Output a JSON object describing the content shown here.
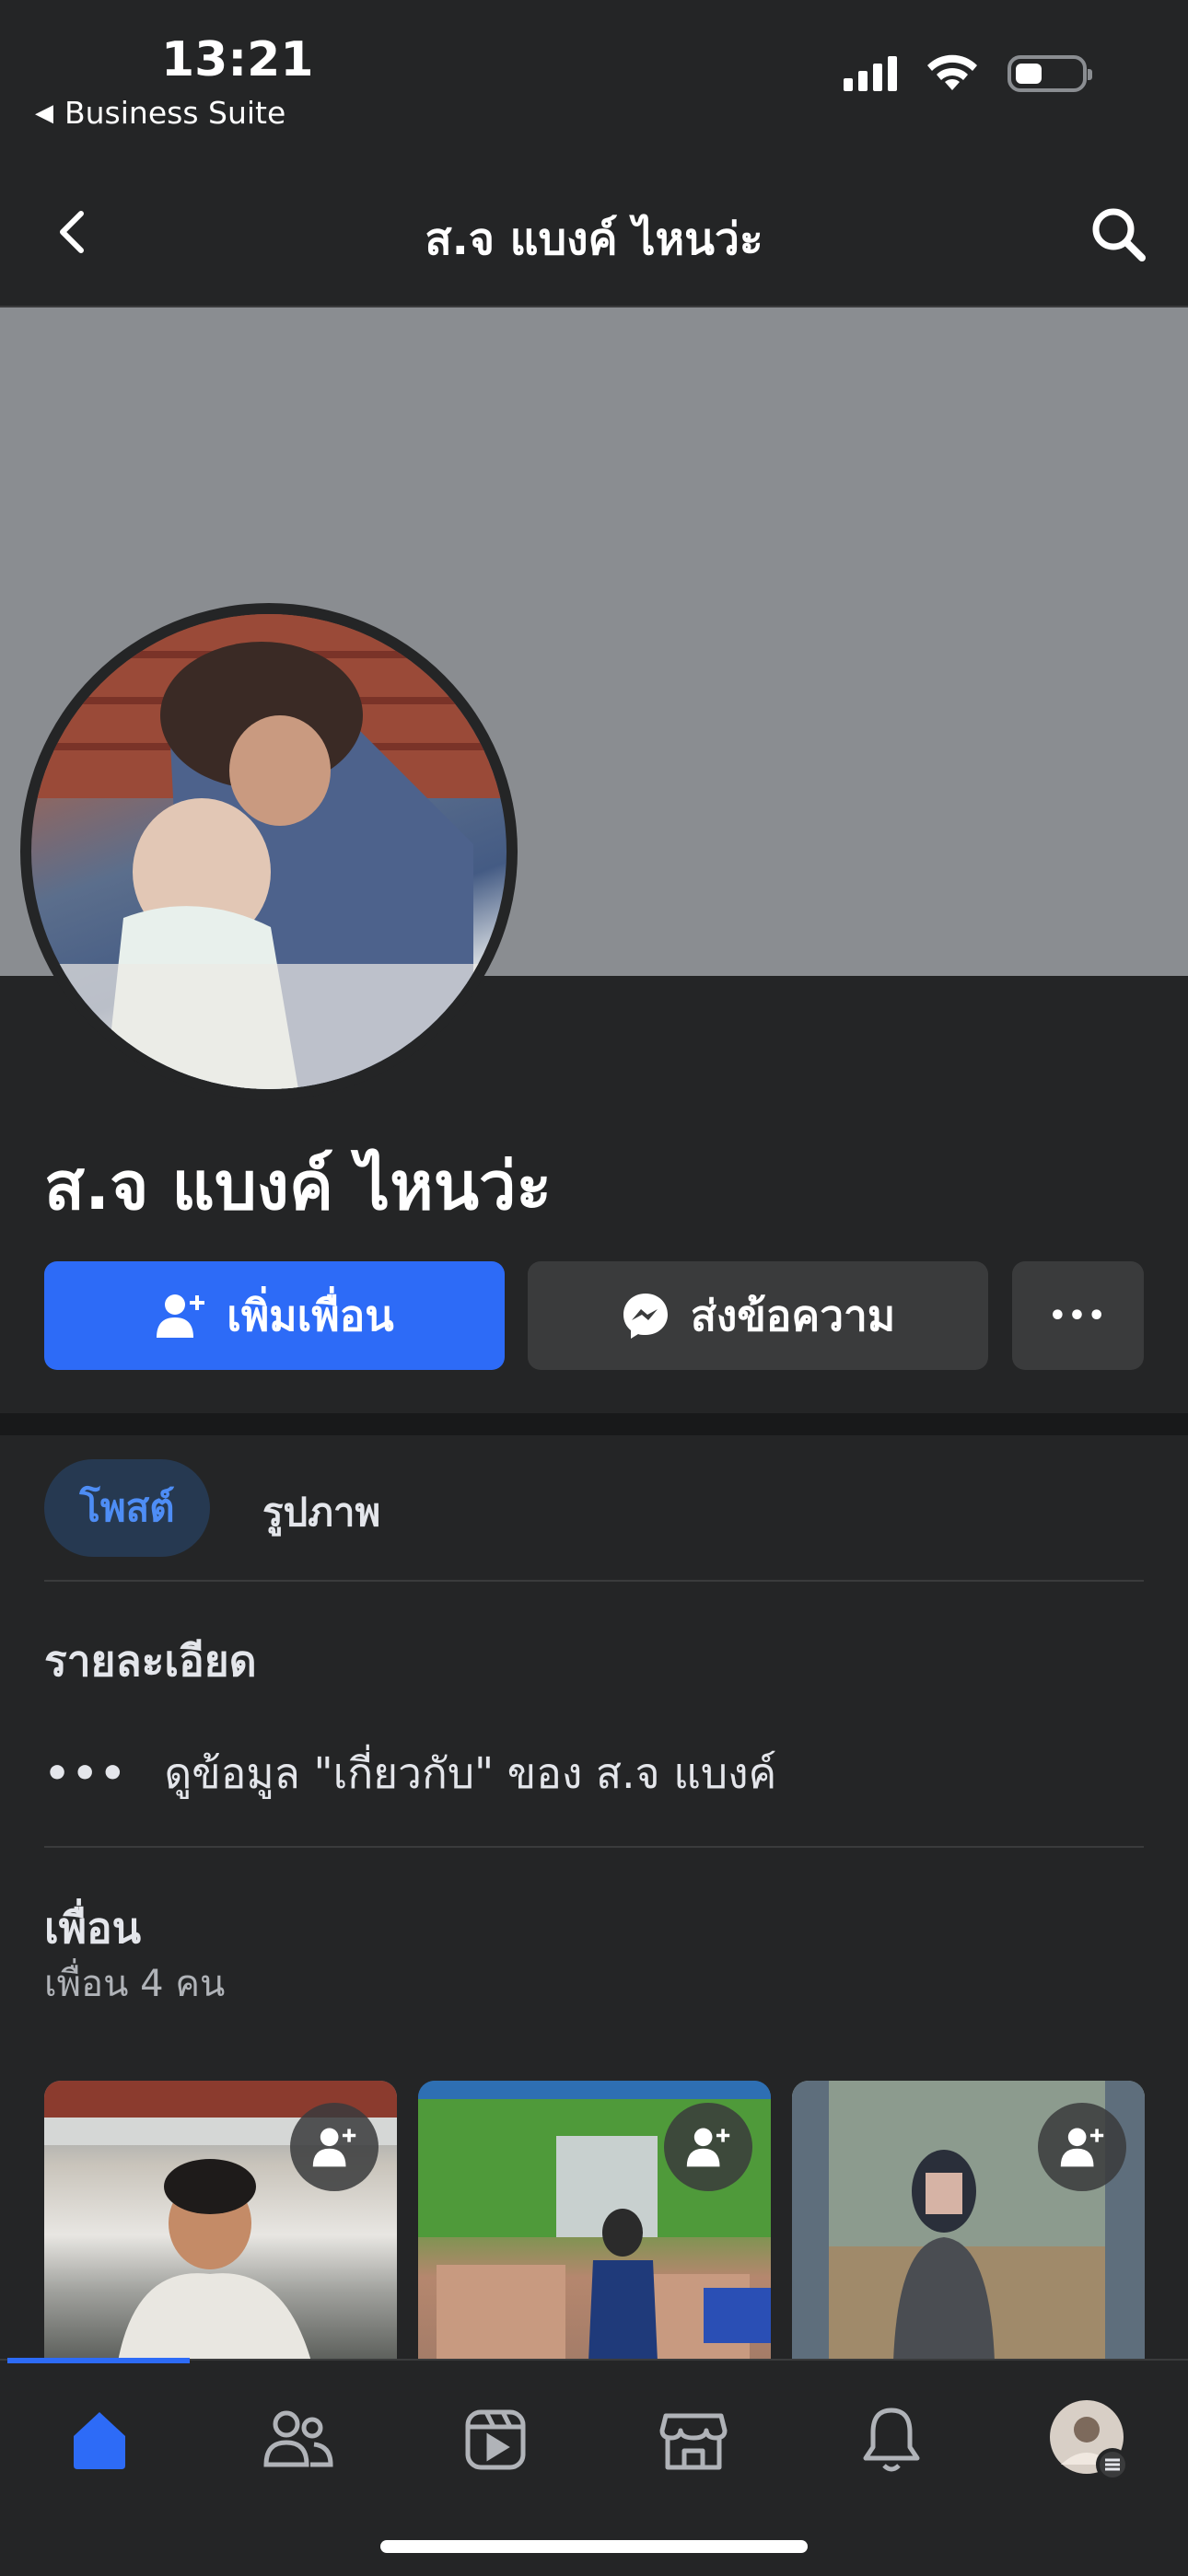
{
  "status_bar": {
    "time": "13:21",
    "back_app": "Business Suite"
  },
  "header": {
    "title": "ส.จ แบงค์ ไหนว่ะ"
  },
  "profile": {
    "name": "ส.จ แบงค์ ไหนว่ะ"
  },
  "actions": {
    "add_friend": "เพิ่มเพื่อน",
    "message": "ส่งข้อความ",
    "more": "•••"
  },
  "tabs": {
    "posts": "โพสต์",
    "photos": "รูปภาพ"
  },
  "details": {
    "title": "รายละเอียด",
    "about_link": "ดูข้อมูล \"เกี่ยวกับ\" ของ ส.จ แบงค์",
    "dots": "•••"
  },
  "friends": {
    "title": "เพื่อน",
    "count_text": "เพื่อน 4 คน"
  },
  "nav": {
    "active": "home"
  },
  "colors": {
    "accent": "#2d6bf7",
    "background": "#242526",
    "cover": "#8a8d91"
  }
}
